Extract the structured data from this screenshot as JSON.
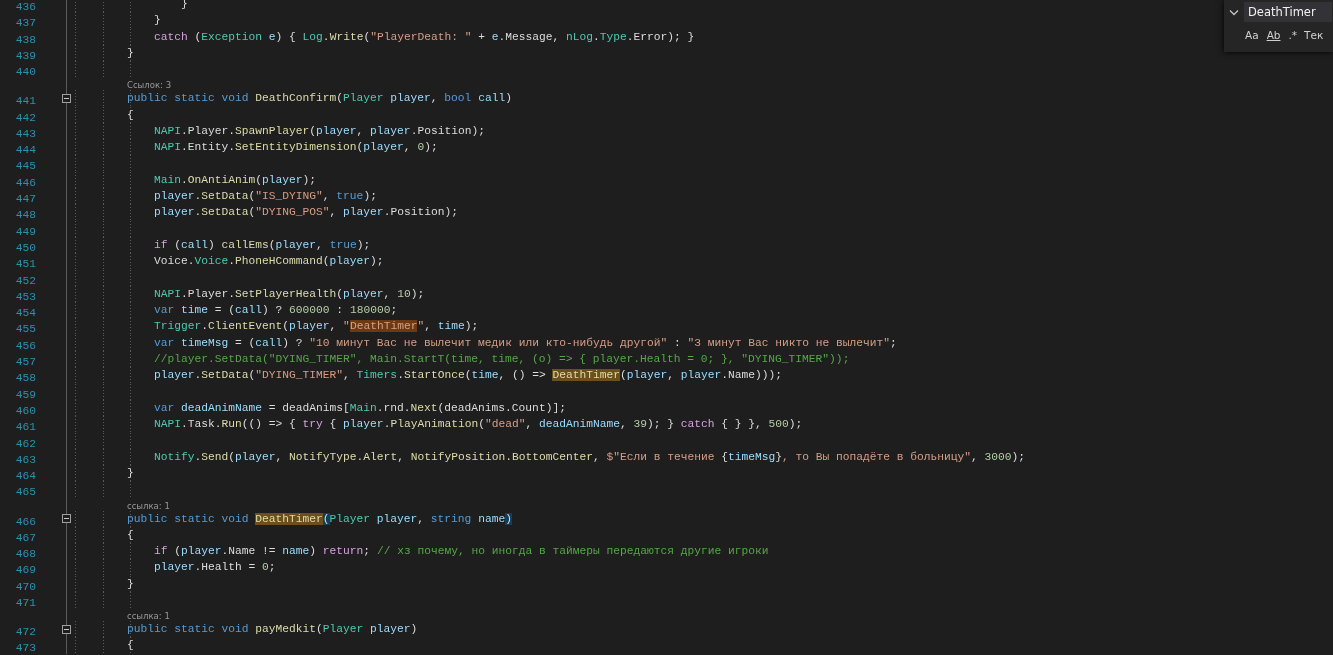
{
  "editor": {
    "rows": [
      {
        "kind": "line",
        "number": "436",
        "tokens": [
          {
            "kind": "plain",
            "text": "                }"
          }
        ]
      },
      {
        "kind": "line",
        "number": "437",
        "tokens": [
          {
            "kind": "plain",
            "text": "            }"
          }
        ]
      },
      {
        "kind": "line",
        "number": "438",
        "tokens": [
          {
            "kind": "control",
            "text": "            catch"
          },
          {
            "kind": "plain",
            "text": " ("
          },
          {
            "kind": "type",
            "text": "Exception"
          },
          {
            "kind": "variable",
            "text": " e"
          },
          {
            "kind": "plain",
            "text": ") { "
          },
          {
            "kind": "type",
            "text": "Log"
          },
          {
            "kind": "plain",
            "text": "."
          },
          {
            "kind": "method",
            "text": "Write"
          },
          {
            "kind": "plain",
            "text": "("
          },
          {
            "kind": "string",
            "text": "\"PlayerDeath: \""
          },
          {
            "kind": "plain",
            "text": " + "
          },
          {
            "kind": "variable",
            "text": "e"
          },
          {
            "kind": "plain",
            "text": ".Message, "
          },
          {
            "kind": "type",
            "text": "nLog"
          },
          {
            "kind": "plain",
            "text": "."
          },
          {
            "kind": "type",
            "text": "Type"
          },
          {
            "kind": "plain",
            "text": ".Error); }"
          }
        ]
      },
      {
        "kind": "line",
        "number": "439",
        "tokens": [
          {
            "kind": "plain",
            "text": "        }"
          }
        ]
      },
      {
        "kind": "line",
        "number": "440"
      },
      {
        "kind": "lens",
        "text": "Ссылок: 3"
      },
      {
        "kind": "fold",
        "number": "441",
        "tokens": [
          {
            "kind": "keyword",
            "text": "        public static void "
          },
          {
            "kind": "method",
            "text": "DeathConfirm"
          },
          {
            "kind": "plain",
            "text": "("
          },
          {
            "kind": "type",
            "text": "Player"
          },
          {
            "kind": "variable",
            "text": " player"
          },
          {
            "kind": "plain",
            "text": ", "
          },
          {
            "kind": "keyword",
            "text": "bool"
          },
          {
            "kind": "variable",
            "text": " call"
          },
          {
            "kind": "plain",
            "text": ")"
          }
        ]
      },
      {
        "kind": "line",
        "number": "442",
        "tokens": [
          {
            "kind": "plain",
            "text": "        {"
          }
        ]
      },
      {
        "kind": "line",
        "number": "443",
        "tokens": [
          {
            "kind": "type",
            "text": "            NAPI"
          },
          {
            "kind": "plain",
            "text": ".Player."
          },
          {
            "kind": "method",
            "text": "SpawnPlayer"
          },
          {
            "kind": "plain",
            "text": "("
          },
          {
            "kind": "variable",
            "text": "player"
          },
          {
            "kind": "plain",
            "text": ", "
          },
          {
            "kind": "variable",
            "text": "player"
          },
          {
            "kind": "plain",
            "text": ".Position);"
          }
        ]
      },
      {
        "kind": "line",
        "number": "444",
        "tokens": [
          {
            "kind": "type",
            "text": "            NAPI"
          },
          {
            "kind": "plain",
            "text": ".Entity."
          },
          {
            "kind": "method",
            "text": "SetEntityDimension"
          },
          {
            "kind": "plain",
            "text": "("
          },
          {
            "kind": "variable",
            "text": "player"
          },
          {
            "kind": "plain",
            "text": ", "
          },
          {
            "kind": "number",
            "text": "0"
          },
          {
            "kind": "plain",
            "text": ");"
          }
        ]
      },
      {
        "kind": "line",
        "number": "445"
      },
      {
        "kind": "line",
        "number": "446",
        "tokens": [
          {
            "kind": "type",
            "text": "            Main"
          },
          {
            "kind": "plain",
            "text": "."
          },
          {
            "kind": "method",
            "text": "OnAntiAnim"
          },
          {
            "kind": "plain",
            "text": "("
          },
          {
            "kind": "variable",
            "text": "player"
          },
          {
            "kind": "plain",
            "text": ");"
          }
        ]
      },
      {
        "kind": "line",
        "number": "447",
        "tokens": [
          {
            "kind": "variable",
            "text": "            player"
          },
          {
            "kind": "plain",
            "text": "."
          },
          {
            "kind": "method",
            "text": "SetData"
          },
          {
            "kind": "plain",
            "text": "("
          },
          {
            "kind": "string",
            "text": "\"IS_DYING\""
          },
          {
            "kind": "plain",
            "text": ", "
          },
          {
            "kind": "keyword",
            "text": "true"
          },
          {
            "kind": "plain",
            "text": ");"
          }
        ]
      },
      {
        "kind": "line",
        "number": "448",
        "tokens": [
          {
            "kind": "variable",
            "text": "            player"
          },
          {
            "kind": "plain",
            "text": "."
          },
          {
            "kind": "method",
            "text": "SetData"
          },
          {
            "kind": "plain",
            "text": "("
          },
          {
            "kind": "string",
            "text": "\"DYING_POS\""
          },
          {
            "kind": "plain",
            "text": ", "
          },
          {
            "kind": "variable",
            "text": "player"
          },
          {
            "kind": "plain",
            "text": ".Position);"
          }
        ]
      },
      {
        "kind": "line",
        "number": "449"
      },
      {
        "kind": "line",
        "number": "450",
        "tokens": [
          {
            "kind": "control",
            "text": "            if"
          },
          {
            "kind": "plain",
            "text": " ("
          },
          {
            "kind": "variable",
            "text": "call"
          },
          {
            "kind": "plain",
            "text": ") "
          },
          {
            "kind": "method",
            "text": "callEms"
          },
          {
            "kind": "plain",
            "text": "("
          },
          {
            "kind": "variable",
            "text": "player"
          },
          {
            "kind": "plain",
            "text": ", "
          },
          {
            "kind": "keyword",
            "text": "true"
          },
          {
            "kind": "plain",
            "text": ");"
          }
        ]
      },
      {
        "kind": "line",
        "number": "451",
        "tokens": [
          {
            "kind": "plain",
            "text": "            Voice."
          },
          {
            "kind": "type",
            "text": "Voice"
          },
          {
            "kind": "plain",
            "text": "."
          },
          {
            "kind": "method",
            "text": "PhoneHCommand"
          },
          {
            "kind": "plain",
            "text": "("
          },
          {
            "kind": "variable",
            "text": "player"
          },
          {
            "kind": "plain",
            "text": ");"
          }
        ]
      },
      {
        "kind": "line",
        "number": "452"
      },
      {
        "kind": "line",
        "number": "453",
        "tokens": [
          {
            "kind": "type",
            "text": "            NAPI"
          },
          {
            "kind": "plain",
            "text": ".Player."
          },
          {
            "kind": "method",
            "text": "SetPlayerHealth"
          },
          {
            "kind": "plain",
            "text": "("
          },
          {
            "kind": "variable",
            "text": "player"
          },
          {
            "kind": "plain",
            "text": ", "
          },
          {
            "kind": "number",
            "text": "10"
          },
          {
            "kind": "plain",
            "text": ");"
          }
        ]
      },
      {
        "kind": "line",
        "number": "454",
        "tokens": [
          {
            "kind": "keyword",
            "text": "            var"
          },
          {
            "kind": "variable",
            "text": " time"
          },
          {
            "kind": "plain",
            "text": " = ("
          },
          {
            "kind": "variable",
            "text": "call"
          },
          {
            "kind": "plain",
            "text": ") ? "
          },
          {
            "kind": "number",
            "text": "600000"
          },
          {
            "kind": "plain",
            "text": " : "
          },
          {
            "kind": "number",
            "text": "180000"
          },
          {
            "kind": "plain",
            "text": ";"
          }
        ]
      },
      {
        "kind": "line",
        "number": "455",
        "tokens": [
          {
            "kind": "type",
            "text": "            Trigger"
          },
          {
            "kind": "plain",
            "text": "."
          },
          {
            "kind": "method",
            "text": "ClientEvent"
          },
          {
            "kind": "plain",
            "text": "("
          },
          {
            "kind": "variable",
            "text": "player"
          },
          {
            "kind": "plain",
            "text": ", "
          },
          {
            "kind": "string",
            "text": "\""
          },
          {
            "kind": "string-match",
            "text": "DeathTimer"
          },
          {
            "kind": "string",
            "text": "\""
          },
          {
            "kind": "plain",
            "text": ", "
          },
          {
            "kind": "variable",
            "text": "time"
          },
          {
            "kind": "plain",
            "text": ");"
          }
        ]
      },
      {
        "kind": "line",
        "number": "456",
        "tokens": [
          {
            "kind": "keyword",
            "text": "            var"
          },
          {
            "kind": "variable",
            "text": " timeMsg"
          },
          {
            "kind": "plain",
            "text": " = ("
          },
          {
            "kind": "variable",
            "text": "call"
          },
          {
            "kind": "plain",
            "text": ") ? "
          },
          {
            "kind": "string",
            "text": "\"10 минут Вас не вылечит медик или кто-нибудь другой\""
          },
          {
            "kind": "plain",
            "text": " : "
          },
          {
            "kind": "string",
            "text": "\"3 минут Вас никто не вылечит\""
          },
          {
            "kind": "plain",
            "text": ";"
          }
        ]
      },
      {
        "kind": "line",
        "number": "457",
        "tokens": [
          {
            "kind": "comment",
            "text": "            //player.SetData(\"DYING_TIMER\", Main.StartT(time, time, (o) => { player.Health = 0; }, \"DYING_TIMER\"));"
          }
        ]
      },
      {
        "kind": "line",
        "number": "458",
        "tokens": [
          {
            "kind": "variable",
            "text": "            player"
          },
          {
            "kind": "plain",
            "text": "."
          },
          {
            "kind": "method",
            "text": "SetData"
          },
          {
            "kind": "plain",
            "text": "("
          },
          {
            "kind": "string",
            "text": "\"DYING_TIMER\""
          },
          {
            "kind": "plain",
            "text": ", "
          },
          {
            "kind": "type",
            "text": "Timers"
          },
          {
            "kind": "plain",
            "text": "."
          },
          {
            "kind": "method",
            "text": "StartOnce"
          },
          {
            "kind": "plain",
            "text": "("
          },
          {
            "kind": "variable",
            "text": "time"
          },
          {
            "kind": "plain",
            "text": ", () => "
          },
          {
            "kind": "method-match",
            "text": "DeathTimer"
          },
          {
            "kind": "plain",
            "text": "("
          },
          {
            "kind": "variable",
            "text": "player"
          },
          {
            "kind": "plain",
            "text": ", "
          },
          {
            "kind": "variable",
            "text": "player"
          },
          {
            "kind": "plain",
            "text": ".Name)));"
          }
        ]
      },
      {
        "kind": "line",
        "number": "459"
      },
      {
        "kind": "line",
        "number": "460",
        "tokens": [
          {
            "kind": "keyword",
            "text": "            var"
          },
          {
            "kind": "variable",
            "text": " deadAnimName"
          },
          {
            "kind": "plain",
            "text": " = deadAnims["
          },
          {
            "kind": "type",
            "text": "Main"
          },
          {
            "kind": "plain",
            "text": ".rnd."
          },
          {
            "kind": "method",
            "text": "Next"
          },
          {
            "kind": "plain",
            "text": "(deadAnims.Count)];"
          }
        ]
      },
      {
        "kind": "line",
        "number": "461",
        "tokens": [
          {
            "kind": "type",
            "text": "            NAPI"
          },
          {
            "kind": "plain",
            "text": ".Task."
          },
          {
            "kind": "method",
            "text": "Run"
          },
          {
            "kind": "plain",
            "text": "(() => { "
          },
          {
            "kind": "control",
            "text": "try"
          },
          {
            "kind": "plain",
            "text": " { "
          },
          {
            "kind": "variable",
            "text": "player"
          },
          {
            "kind": "plain",
            "text": "."
          },
          {
            "kind": "method",
            "text": "PlayAnimation"
          },
          {
            "kind": "plain",
            "text": "("
          },
          {
            "kind": "string",
            "text": "\"dead\""
          },
          {
            "kind": "plain",
            "text": ", "
          },
          {
            "kind": "variable",
            "text": "deadAnimName"
          },
          {
            "kind": "plain",
            "text": ", "
          },
          {
            "kind": "number",
            "text": "39"
          },
          {
            "kind": "plain",
            "text": "); } "
          },
          {
            "kind": "control",
            "text": "catch"
          },
          {
            "kind": "plain",
            "text": " { } }, "
          },
          {
            "kind": "number",
            "text": "500"
          },
          {
            "kind": "plain",
            "text": ");"
          }
        ]
      },
      {
        "kind": "line",
        "number": "462"
      },
      {
        "kind": "line",
        "number": "463",
        "tokens": [
          {
            "kind": "type",
            "text": "            Notify"
          },
          {
            "kind": "plain",
            "text": "."
          },
          {
            "kind": "method",
            "text": "Send"
          },
          {
            "kind": "plain",
            "text": "("
          },
          {
            "kind": "variable",
            "text": "player"
          },
          {
            "kind": "plain",
            "text": ", "
          },
          {
            "kind": "method",
            "text": "NotifyType.Alert"
          },
          {
            "kind": "plain",
            "text": ", "
          },
          {
            "kind": "method",
            "text": "NotifyPosition.BottomCenter"
          },
          {
            "kind": "plain",
            "text": ", "
          },
          {
            "kind": "string",
            "text": "$\"Если в течение "
          },
          {
            "kind": "plain",
            "text": "{"
          },
          {
            "kind": "variable",
            "text": "timeMsg"
          },
          {
            "kind": "plain",
            "text": "}"
          },
          {
            "kind": "string",
            "text": ", то Вы попадёте в больницу\""
          },
          {
            "kind": "plain",
            "text": ", "
          },
          {
            "kind": "number",
            "text": "3000"
          },
          {
            "kind": "plain",
            "text": ");"
          }
        ]
      },
      {
        "kind": "line",
        "number": "464",
        "tokens": [
          {
            "kind": "plain",
            "text": "        }"
          }
        ]
      },
      {
        "kind": "line",
        "number": "465"
      },
      {
        "kind": "lens",
        "text": "ссылка: 1"
      },
      {
        "kind": "fold",
        "number": "466",
        "tokens": [
          {
            "kind": "keyword",
            "text": "        public static void "
          },
          {
            "kind": "method-match",
            "text": "DeathTimer"
          },
          {
            "kind": "brace",
            "text": "("
          },
          {
            "kind": "type",
            "text": "Player"
          },
          {
            "kind": "variable",
            "text": " player"
          },
          {
            "kind": "plain",
            "text": ", "
          },
          {
            "kind": "keyword",
            "text": "string"
          },
          {
            "kind": "variable",
            "text": " name"
          },
          {
            "kind": "brace",
            "text": ")"
          }
        ]
      },
      {
        "kind": "line",
        "number": "467",
        "tokens": [
          {
            "kind": "plain",
            "text": "        {"
          }
        ]
      },
      {
        "kind": "line",
        "number": "468",
        "tokens": [
          {
            "kind": "control",
            "text": "            if"
          },
          {
            "kind": "plain",
            "text": " ("
          },
          {
            "kind": "variable",
            "text": "player"
          },
          {
            "kind": "plain",
            "text": ".Name != "
          },
          {
            "kind": "variable",
            "text": "name"
          },
          {
            "kind": "plain",
            "text": ") "
          },
          {
            "kind": "control",
            "text": "return"
          },
          {
            "kind": "plain",
            "text": "; "
          },
          {
            "kind": "comment",
            "text": "// хз почему, но иногда в таймеры передаются другие игроки"
          }
        ]
      },
      {
        "kind": "line",
        "number": "469",
        "tokens": [
          {
            "kind": "variable",
            "text": "            player"
          },
          {
            "kind": "plain",
            "text": ".Health = "
          },
          {
            "kind": "number",
            "text": "0"
          },
          {
            "kind": "plain",
            "text": ";"
          }
        ]
      },
      {
        "kind": "line",
        "number": "470",
        "tokens": [
          {
            "kind": "plain",
            "text": "        }"
          }
        ]
      },
      {
        "kind": "line",
        "number": "471"
      },
      {
        "kind": "lens",
        "text": "ссылка: 1"
      },
      {
        "kind": "fold",
        "number": "472",
        "tokens": [
          {
            "kind": "keyword",
            "text": "        public static void "
          },
          {
            "kind": "method",
            "text": "payMedkit"
          },
          {
            "kind": "plain",
            "text": "("
          },
          {
            "kind": "type",
            "text": "Player"
          },
          {
            "kind": "variable",
            "text": " player"
          },
          {
            "kind": "plain",
            "text": ")"
          }
        ]
      },
      {
        "kind": "line",
        "number": "473",
        "tokens": [
          {
            "kind": "plain",
            "text": "        {"
          }
        ]
      }
    ]
  },
  "find_widget": {
    "value": "DeathTimer",
    "options": [
      "Aa",
      "Ab",
      ".*"
    ],
    "scope": "Тек"
  }
}
